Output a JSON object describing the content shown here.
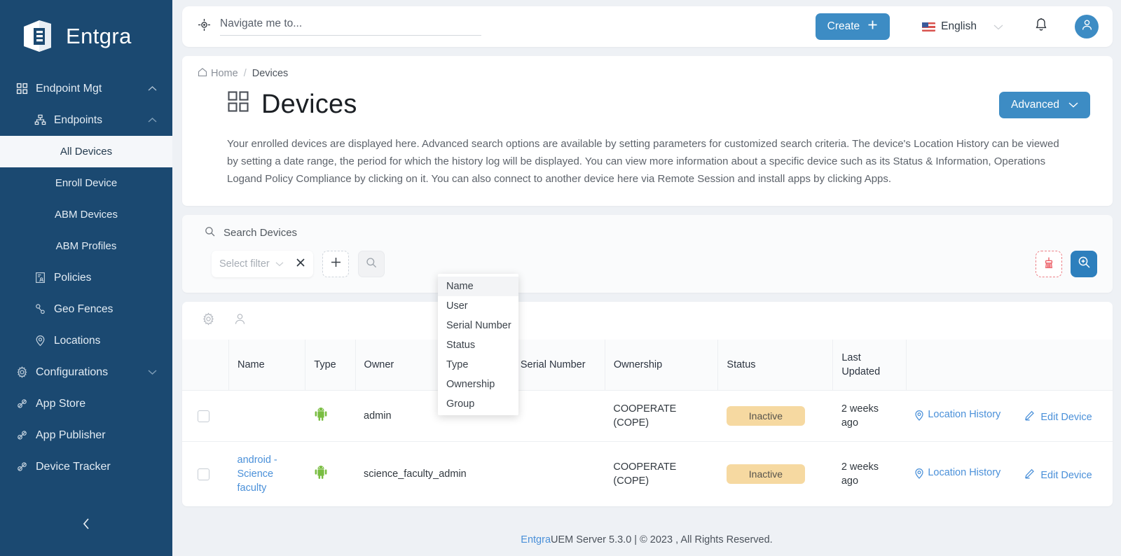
{
  "brand": {
    "name": "Entgra",
    "logo_icon": "entgra-logo-icon"
  },
  "sidebar": {
    "items": [
      {
        "label": "Endpoint Mgt",
        "icon": "grid-icon",
        "level": 1,
        "chevron": "chevron-up-icon",
        "active": false
      },
      {
        "label": "Endpoints",
        "icon": "sitemap-icon",
        "level": 2,
        "chevron": "chevron-up-icon",
        "active": false
      },
      {
        "label": "All Devices",
        "icon": "",
        "level": 3,
        "chevron": "",
        "active": true
      },
      {
        "label": "Enroll Device",
        "icon": "",
        "level": 3,
        "chevron": "",
        "active": false
      },
      {
        "label": "ABM Devices",
        "icon": "",
        "level": 3,
        "chevron": "",
        "active": false
      },
      {
        "label": "ABM Profiles",
        "icon": "",
        "level": 3,
        "chevron": "",
        "active": false
      },
      {
        "label": "Policies",
        "icon": "policy-icon",
        "level": 2,
        "chevron": "",
        "active": false
      },
      {
        "label": "Geo Fences",
        "icon": "geofence-icon",
        "level": 2,
        "chevron": "",
        "active": false
      },
      {
        "label": "Locations",
        "icon": "location-pin-icon",
        "level": 2,
        "chevron": "",
        "active": false
      },
      {
        "label": "Configurations",
        "icon": "gear-icon",
        "level": 1,
        "chevron": "chevron-down-icon",
        "active": false
      },
      {
        "label": "App Store",
        "icon": "apps-icon",
        "level": 1,
        "chevron": "",
        "active": false
      },
      {
        "label": "App Publisher",
        "icon": "apps-icon",
        "level": 1,
        "chevron": "",
        "active": false
      },
      {
        "label": "Device Tracker",
        "icon": "apps-icon",
        "level": 1,
        "chevron": "",
        "active": false
      }
    ],
    "collapse_icon": "chevron-left-icon",
    "bg_color": "#1b4971"
  },
  "topbar": {
    "navigate_placeholder": "Navigate me to...",
    "navigate_value": "",
    "navigate_icon": "navigate-target-icon",
    "create_label": "Create",
    "create_icon": "plus-icon",
    "language": "English",
    "language_chevron": "chevron-down-icon",
    "notifications_icon": "bell-icon",
    "avatar_icon": "user-avatar-icon",
    "accent_color": "#3d8cc4"
  },
  "breadcrumb": {
    "home": "Home",
    "separator": "/",
    "current": "Devices",
    "home_icon": "home-icon"
  },
  "page": {
    "title": "Devices",
    "title_icon": "grid-icon",
    "advanced_label": "Advanced",
    "advanced_chevron": "chevron-down-icon",
    "description": "Your enrolled devices are displayed here. Advanced search options are available by setting parameters for customized search criteria. The device's Location History can be viewed by setting a date range, the period for which the history log will be displayed. You can view more information about a specific device such as its Status & Information, Operations Logand Policy Compliance by clicking on it. You can also connect to another device here via Remote Session and install apps by clicking Apps."
  },
  "search": {
    "heading": "Search Devices",
    "heading_icon": "search-icon",
    "select_filter_label": "Select filter",
    "select_filter_chevron": "chevron-down-icon",
    "clear_icon": "close-x-icon",
    "add_icon": "plus-icon",
    "search_box_icon": "search-icon",
    "clean_icon": "broom-icon",
    "magnify_icon": "search-plus-icon",
    "filter_options": [
      {
        "label": "Name",
        "highlighted": true
      },
      {
        "label": "User",
        "highlighted": false
      },
      {
        "label": "Serial Number",
        "highlighted": false
      },
      {
        "label": "Status",
        "highlighted": false
      },
      {
        "label": "Type",
        "highlighted": false
      },
      {
        "label": "Ownership",
        "highlighted": false
      },
      {
        "label": "Group",
        "highlighted": false
      }
    ]
  },
  "table": {
    "toolbar_icons": [
      "settings-gear-icon",
      "user-icon"
    ],
    "columns": [
      "",
      "Name",
      "Type",
      "Owner",
      "Serial Number",
      "Ownership",
      "Status",
      "Last Updated",
      ""
    ],
    "rows": [
      {
        "name": "",
        "type_icon": "android-icon",
        "owner": "admin",
        "serial": "",
        "ownership": "COOPERATE (COPE)",
        "status": "Inactive",
        "last_updated": "2 weeks ago",
        "location_label": "Location History",
        "location_icon": "location-pin-icon",
        "edit_label": "Edit Device",
        "edit_icon": "pencil-icon"
      },
      {
        "name": "android - Science faculty",
        "type_icon": "android-icon",
        "owner": "science_faculty_admin",
        "serial": "",
        "ownership": "COOPERATE (COPE)",
        "status": "Inactive",
        "last_updated": "2 weeks ago",
        "location_label": "Location History",
        "location_icon": "location-pin-icon",
        "edit_label": "Edit Device",
        "edit_icon": "pencil-icon"
      }
    ],
    "status_badge_color": "#f6d9a1"
  },
  "footer": {
    "brand": "Entgra",
    "text": " UEM Server 5.3.0 | © 2023 , All Rights Reserved."
  }
}
